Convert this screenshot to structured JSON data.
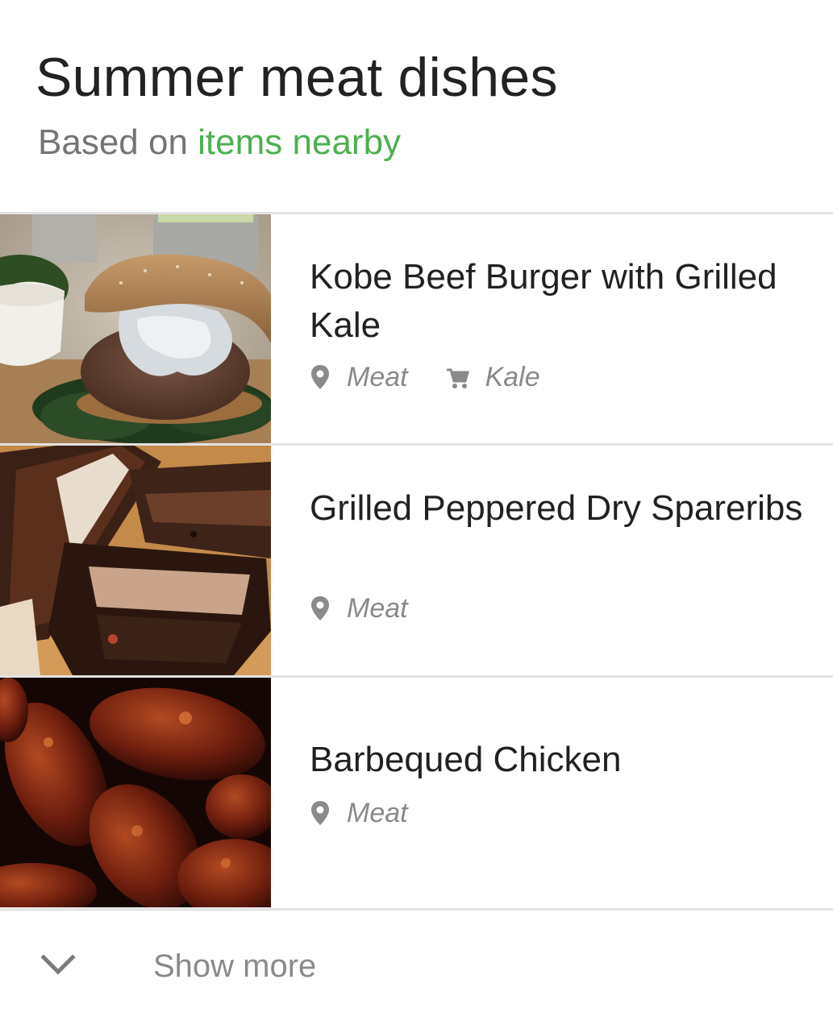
{
  "header": {
    "title": "Summer meat dishes",
    "subtitle_prefix": "Based on ",
    "subtitle_link": "items nearby",
    "link_color": "#4caf50"
  },
  "recipes": [
    {
      "title": "Kobe Beef Burger with Grilled Kale",
      "image_icon": "burger-photo",
      "tags": [
        {
          "icon": "location-pin-icon",
          "label": "Meat"
        },
        {
          "icon": "shopping-cart-icon",
          "label": "Kale"
        }
      ]
    },
    {
      "title": "Grilled Peppered Dry Spareribs",
      "image_icon": "spareribs-photo",
      "tags": [
        {
          "icon": "location-pin-icon",
          "label": "Meat"
        }
      ]
    },
    {
      "title": "Barbequed Chicken",
      "image_icon": "bbq-chicken-photo",
      "tags": [
        {
          "icon": "location-pin-icon",
          "label": "Meat"
        }
      ]
    }
  ],
  "footer": {
    "show_more_label": "Show more",
    "show_more_icon": "chevron-down-icon"
  }
}
